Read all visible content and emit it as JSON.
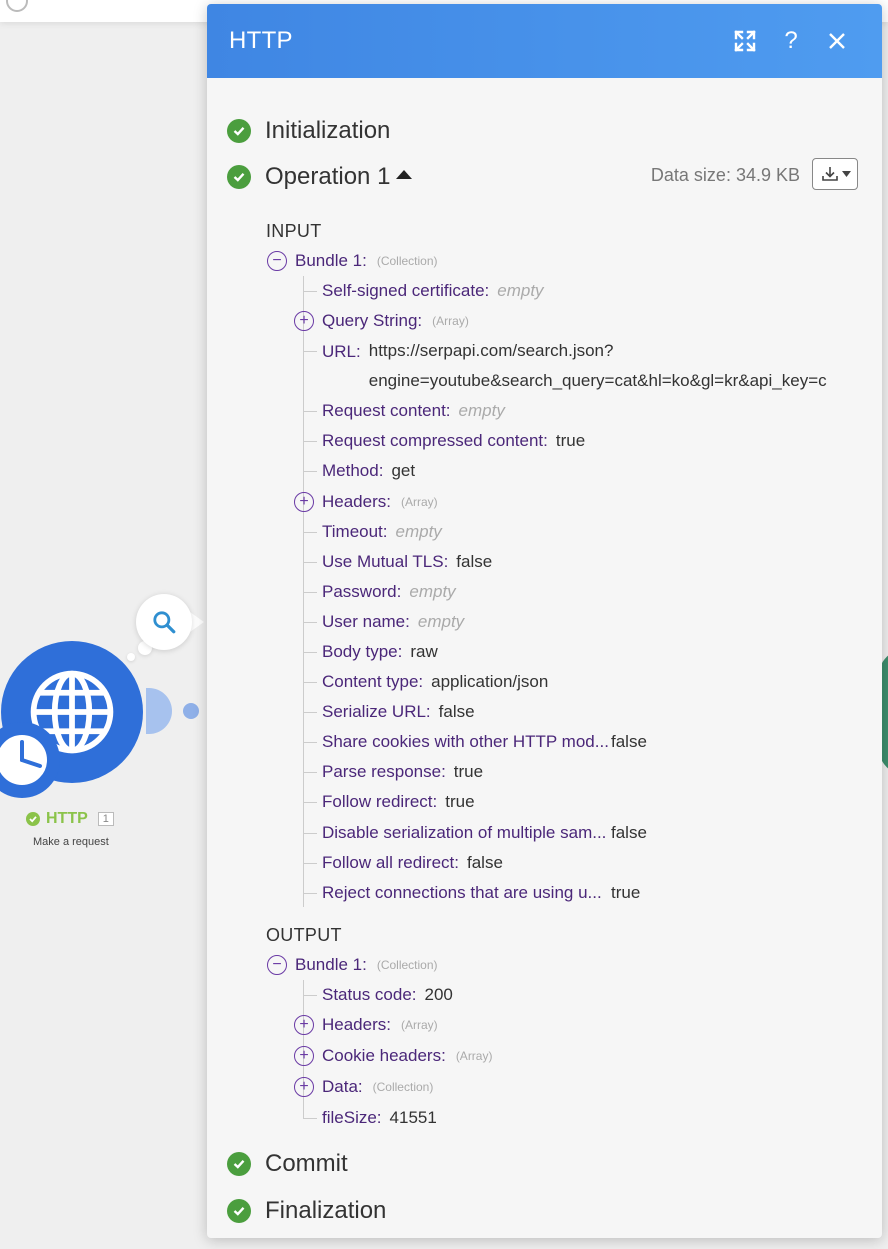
{
  "canvas": {
    "module_name": "HTTP",
    "module_count": "1",
    "module_subtitle": "Make a request"
  },
  "dialog": {
    "title": "HTTP",
    "phases": {
      "initialization": "Initialization",
      "operation": "Operation 1",
      "commit": "Commit",
      "finalization": "Finalization"
    },
    "data_size": "Data size: 34.9 KB",
    "input_label": "INPUT",
    "output_label": "OUTPUT",
    "input_bundle": {
      "label": "Bundle 1:",
      "type": "(Collection)",
      "fields": {
        "self_signed": {
          "k": "Self-signed certificate:",
          "v": "empty"
        },
        "query_string": {
          "k": "Query String:",
          "type": "(Array)"
        },
        "url": {
          "k": "URL:",
          "v1": "https://serpapi.com/search.json?",
          "v2": "engine=youtube&search_query=cat&hl=ko&gl=kr&api_key=c"
        },
        "request_content": {
          "k": "Request content:",
          "v": "empty"
        },
        "request_compressed": {
          "k": "Request compressed content:",
          "v": "true"
        },
        "method": {
          "k": "Method:",
          "v": "get"
        },
        "headers": {
          "k": "Headers:",
          "type": "(Array)"
        },
        "timeout": {
          "k": "Timeout:",
          "v": "empty"
        },
        "mutual_tls": {
          "k": "Use Mutual TLS:",
          "v": "false"
        },
        "password": {
          "k": "Password:",
          "v": "empty"
        },
        "username": {
          "k": "User name:",
          "v": "empty"
        },
        "body_type": {
          "k": "Body type:",
          "v": "raw"
        },
        "content_type": {
          "k": "Content type:",
          "v": "application/json"
        },
        "serialize_url": {
          "k": "Serialize URL:",
          "v": "false"
        },
        "share_cookies": {
          "k": "Share cookies with other HTTP mod...",
          "v": "false"
        },
        "parse_response": {
          "k": "Parse response:",
          "v": "true"
        },
        "follow_redirect": {
          "k": "Follow redirect:",
          "v": "true"
        },
        "disable_serialization": {
          "k": "Disable serialization of multiple sam...",
          "v": "false"
        },
        "follow_all_redirect": {
          "k": "Follow all redirect:",
          "v": "false"
        },
        "reject_connections": {
          "k": "Reject connections that are using u...",
          "v": "true"
        }
      }
    },
    "output_bundle": {
      "label": "Bundle 1:",
      "type": "(Collection)",
      "fields": {
        "status_code": {
          "k": "Status code:",
          "v": "200"
        },
        "headers": {
          "k": "Headers:",
          "type": "(Array)"
        },
        "cookie_headers": {
          "k": "Cookie headers:",
          "type": "(Array)"
        },
        "data": {
          "k": "Data:",
          "type": "(Collection)"
        },
        "file_size": {
          "k": "fileSize:",
          "v": "41551"
        }
      }
    }
  },
  "colors": {
    "header_blue": "#4f9cf0",
    "module_blue": "#2f6fd9",
    "success_green": "#4b9e3e",
    "key_purple": "#4b2779"
  }
}
